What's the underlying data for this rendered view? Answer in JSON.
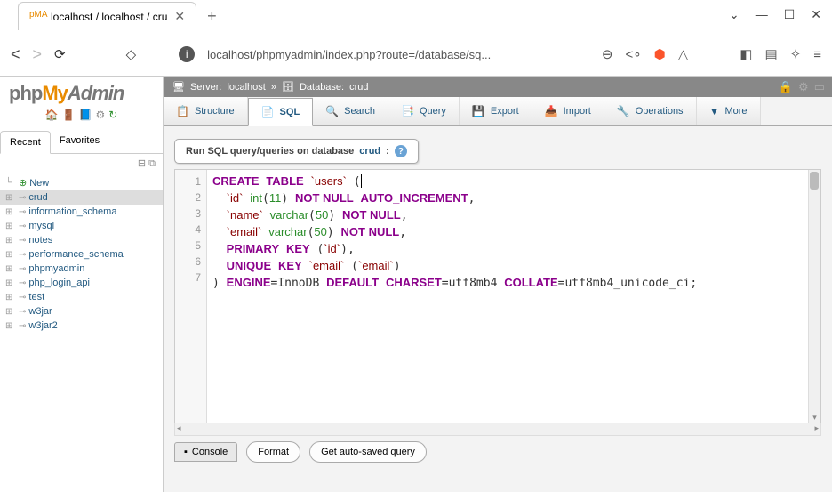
{
  "browser": {
    "tab_title": "localhost / localhost / cru",
    "url": "localhost/phpmyadmin/index.php?route=/database/sq...",
    "window_controls": {
      "minimize": "—",
      "maximize": "☐",
      "close": "✕"
    }
  },
  "sidebar": {
    "logo_php": "php",
    "logo_my": "My",
    "logo_admin": "Admin",
    "recent": "Recent",
    "favorites": "Favorites",
    "tree": [
      {
        "label": "New",
        "new": true
      },
      {
        "label": "crud",
        "highlighted": true
      },
      {
        "label": "information_schema"
      },
      {
        "label": "mysql"
      },
      {
        "label": "notes"
      },
      {
        "label": "performance_schema"
      },
      {
        "label": "phpmyadmin"
      },
      {
        "label": "php_login_api"
      },
      {
        "label": "test"
      },
      {
        "label": "w3jar"
      },
      {
        "label": "w3jar2"
      }
    ]
  },
  "breadcrumb": {
    "server_label": "Server:",
    "server": "localhost",
    "db_label": "Database:",
    "db": "crud"
  },
  "tabs": [
    {
      "icon": "📋",
      "label": "Structure"
    },
    {
      "icon": "📄",
      "label": "SQL",
      "active": true
    },
    {
      "icon": "🔍",
      "label": "Search"
    },
    {
      "icon": "📑",
      "label": "Query"
    },
    {
      "icon": "💾",
      "label": "Export"
    },
    {
      "icon": "📥",
      "label": "Import"
    },
    {
      "icon": "🔧",
      "label": "Operations"
    },
    {
      "icon": "▼",
      "label": "More"
    }
  ],
  "query": {
    "label_prefix": "Run SQL query/queries on database ",
    "db_name": "crud",
    "label_suffix": ":"
  },
  "sql": {
    "lines": [
      "1",
      "2",
      "3",
      "4",
      "5",
      "6",
      "7"
    ]
  },
  "bottom": {
    "console": "Console",
    "format": "Format",
    "get_auto": "Get auto-saved query"
  }
}
